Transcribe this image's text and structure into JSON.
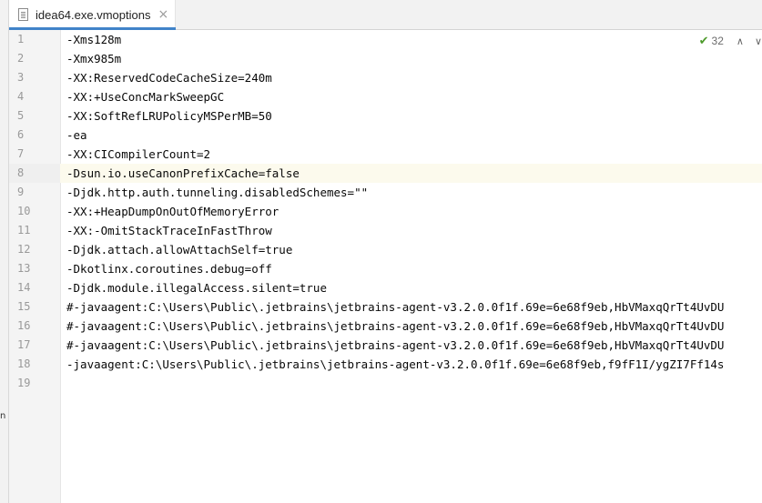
{
  "tab": {
    "title": "idea64.exe.vmoptions",
    "close_glyph": "×",
    "active": true
  },
  "left_strip_glyph": "n",
  "inspections": {
    "count": "32",
    "icon": "double-check-icon",
    "up_arrow": "∧",
    "down_arrow": "∨"
  },
  "current_line": 8,
  "lines": [
    {
      "n": "1",
      "text": "-Xms128m"
    },
    {
      "n": "2",
      "text": "-Xmx985m"
    },
    {
      "n": "3",
      "text": "-XX:ReservedCodeCacheSize=240m"
    },
    {
      "n": "4",
      "text": "-XX:+UseConcMarkSweepGC"
    },
    {
      "n": "5",
      "text": "-XX:SoftRefLRUPolicyMSPerMB=50"
    },
    {
      "n": "6",
      "text": "-ea"
    },
    {
      "n": "7",
      "text": "-XX:CICompilerCount=2"
    },
    {
      "n": "8",
      "text": "-Dsun.io.useCanonPrefixCache=false"
    },
    {
      "n": "9",
      "text": "-Djdk.http.auth.tunneling.disabledSchemes=\"\""
    },
    {
      "n": "10",
      "text": "-XX:+HeapDumpOnOutOfMemoryError"
    },
    {
      "n": "11",
      "text": "-XX:-OmitStackTraceInFastThrow"
    },
    {
      "n": "12",
      "text": "-Djdk.attach.allowAttachSelf=true"
    },
    {
      "n": "13",
      "text": "-Dkotlinx.coroutines.debug=off"
    },
    {
      "n": "14",
      "text": "-Djdk.module.illegalAccess.silent=true"
    },
    {
      "n": "15",
      "text": "#-javaagent:C:\\Users\\Public\\.jetbrains\\jetbrains-agent-v3.2.0.0f1f.69e=6e68f9eb,HbVMaxqQrTt4UvDU"
    },
    {
      "n": "16",
      "text": "#-javaagent:C:\\Users\\Public\\.jetbrains\\jetbrains-agent-v3.2.0.0f1f.69e=6e68f9eb,HbVMaxqQrTt4UvDU"
    },
    {
      "n": "17",
      "text": "#-javaagent:C:\\Users\\Public\\.jetbrains\\jetbrains-agent-v3.2.0.0f1f.69e=6e68f9eb,HbVMaxqQrTt4UvDU"
    },
    {
      "n": "18",
      "text": "-javaagent:C:\\Users\\Public\\.jetbrains\\jetbrains-agent-v3.2.0.0f1f.69e=6e68f9eb,f9fF1I/ygZI7Ff14s"
    },
    {
      "n": "19",
      "text": ""
    }
  ]
}
